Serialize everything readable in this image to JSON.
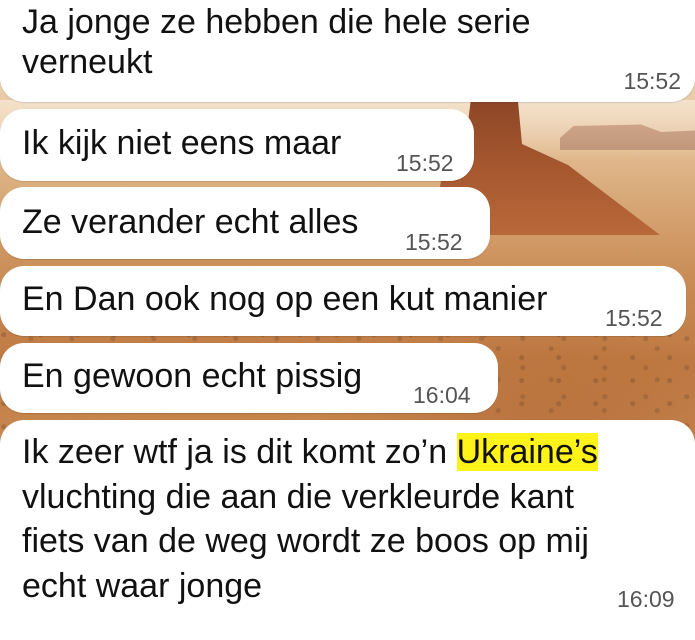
{
  "messages": [
    {
      "text": "Ja jonge ze hebben die hele serie\nverneukt",
      "time": "15:52"
    },
    {
      "text": "Ik kijk niet eens maar",
      "time": "15:52"
    },
    {
      "text": "Ze verander echt alles",
      "time": "15:52"
    },
    {
      "text": "En Dan ook nog op een kut manier",
      "time": "15:52"
    },
    {
      "text": "En gewoon echt pissig",
      "time": "16:04"
    },
    {
      "text_before": "Ik zeer wtf ja is dit komt zo’n ",
      "highlight": "Ukraine’s",
      "text_after": "\nvluchting die aan die verkleurde kant\nfiets van de weg wordt ze boos op mij\necht waar jonge",
      "time": "16:09"
    }
  ],
  "colors": {
    "bubble": "#ffffff",
    "highlight": "#fff31a",
    "text": "#111111",
    "timestamp": "#555555"
  },
  "wallpaper": {
    "subject": "desert-butte-landscape"
  }
}
